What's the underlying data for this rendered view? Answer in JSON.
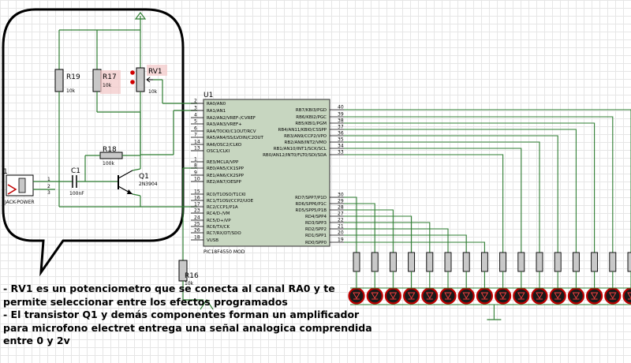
{
  "components": {
    "r19": {
      "ref": "R19",
      "value": "10k"
    },
    "r17": {
      "ref": "R17",
      "value": "10k"
    },
    "rv1": {
      "ref": "RV1",
      "value": "10k"
    },
    "r18": {
      "ref": "R18",
      "value": "100k"
    },
    "c1": {
      "ref": "C1",
      "value": "100nF"
    },
    "q1": {
      "ref": "Q1",
      "value": "2N3904"
    },
    "jack": {
      "ref": "1",
      "value": "JACK-POWER"
    },
    "r16": {
      "ref": "R16",
      "value": "10k"
    },
    "u1": {
      "ref": "U1",
      "part": "PIC18F4550 MOD"
    }
  },
  "left_pins": [
    {
      "num": "2",
      "name": "RA0/AN0"
    },
    {
      "num": "3",
      "name": "RA1/AN1"
    },
    {
      "num": "4",
      "name": "RA2/AN2/VREF-/CVREF"
    },
    {
      "num": "5",
      "name": "RA3/AN3/VREF+"
    },
    {
      "num": "6",
      "name": "RA4/T0CKI/C1OUT/RCV"
    },
    {
      "num": "7",
      "name": "RA5/AN4/SS/LVDIN/C2OUT"
    },
    {
      "num": "14",
      "name": "RA6/OSC2/CLKO"
    },
    {
      "num": "13",
      "name": "OSC1/CLKI"
    },
    {
      "num": "1",
      "name": "RE3/MCLR/VPP"
    },
    {
      "num": "8",
      "name": "RE0/AN5/CK1SPP"
    },
    {
      "num": "9",
      "name": "RE1/AN6/CK2SPP"
    },
    {
      "num": "10",
      "name": "RE2/AN7/OESPP"
    },
    {
      "num": "15",
      "name": "RC0/T1OSO/T1CKI"
    },
    {
      "num": "16",
      "name": "RC1/T1OSI/CCP2/UOE"
    },
    {
      "num": "17",
      "name": "RC2/CCP1/P1A"
    },
    {
      "num": "23",
      "name": "RC4/D-/VM"
    },
    {
      "num": "24",
      "name": "RC5/D+/VP"
    },
    {
      "num": "25",
      "name": "RC6/TX/CK"
    },
    {
      "num": "26",
      "name": "RC7/RX/DT/SDO"
    },
    {
      "num": "18",
      "name": "VUSB"
    }
  ],
  "right_pins": [
    {
      "num": "40",
      "name": "RB7/KBI3/PGD"
    },
    {
      "num": "39",
      "name": "RB6/KBI2/PGC"
    },
    {
      "num": "38",
      "name": "RB5/KBI1/PGM"
    },
    {
      "num": "37",
      "name": "RB4/AN11/KBI0/CSSPP"
    },
    {
      "num": "36",
      "name": "RB3/AN9/CCP2/VPO"
    },
    {
      "num": "35",
      "name": "RB2/AN8/INT2/VMO"
    },
    {
      "num": "34",
      "name": "RB1/AN10/INT1/SCK/SCL"
    },
    {
      "num": "33",
      "name": "RB0/AN12/INT0/FLT0/SDI/SDA"
    },
    {
      "num": "30",
      "name": "RD7/SPP7/P1D"
    },
    {
      "num": "29",
      "name": "RD6/SPP6/P1C"
    },
    {
      "num": "28",
      "name": "RD5/SPP5/P1B"
    },
    {
      "num": "27",
      "name": "RD4/SPP4"
    },
    {
      "num": "22",
      "name": "RD3/SPP3"
    },
    {
      "num": "21",
      "name": "RD2/SPP2"
    },
    {
      "num": "20",
      "name": "RD1/SPP1"
    },
    {
      "num": "19",
      "name": "RD0/SPP0"
    }
  ],
  "notes": [
    "- RV1 es un potenciometro que se conecta al canal RA0 y te\npermite seleccionar entre los efectos programados",
    "- El transistor Q1 y demás componentes forman un amplificador\npara microfono electret entrega una señal analogica comprendida\nentre 0 y 2v"
  ],
  "led_count": 16,
  "colors": {
    "wire": "#2e7d32",
    "chip": "#c7d6c0",
    "led_ring": "#c00000",
    "led_fill": "#1a1a1a",
    "grid": "#e6e6e6",
    "highlight": "#f2c6c6"
  }
}
